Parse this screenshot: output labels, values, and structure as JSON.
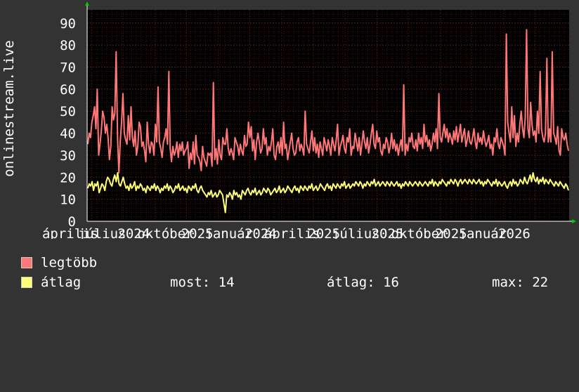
{
  "chart_data": {
    "type": "line",
    "ylabel": "onlinestream.live",
    "ylim": [
      0,
      96
    ],
    "y_ticks": [
      "0",
      "10",
      "20",
      "30",
      "40",
      "50",
      "60",
      "70",
      "80",
      "90"
    ],
    "x_tick_labels": [
      "április",
      "július",
      "2024",
      "október",
      "2025",
      "január",
      "2024",
      "április",
      "2025",
      "július",
      "2025",
      "október",
      "2025",
      "január",
      "2026"
    ],
    "grid": true,
    "background": "#000000",
    "grid_color": "#5a1f1f",
    "series": [
      {
        "name": "legtöbb",
        "color": "#ff7777",
        "values": [
          35,
          40,
          38,
          45,
          48,
          52,
          42,
          60,
          30,
          35,
          41,
          50,
          47,
          40,
          44,
          38,
          28,
          34,
          52,
          46,
          49,
          77,
          38,
          22,
          36,
          45,
          58,
          40,
          37,
          35,
          48,
          37,
          52,
          38,
          34,
          41,
          30,
          34,
          45,
          43,
          34,
          36,
          32,
          27,
          45,
          35,
          31,
          36,
          35,
          30,
          44,
          36,
          61,
          36,
          33,
          29,
          36,
          38,
          42,
          35,
          68,
          33,
          27,
          34,
          30,
          32,
          36,
          29,
          35,
          32,
          36,
          30,
          32,
          33,
          36,
          24,
          31,
          28,
          36,
          26,
          39,
          30,
          29,
          27,
          23,
          34,
          29,
          27,
          25,
          31,
          30,
          31,
          25,
          63,
          28,
          33,
          26,
          37,
          30,
          28,
          38,
          35,
          35,
          42,
          33,
          30,
          33,
          31,
          28,
          38,
          36,
          34,
          30,
          35,
          32,
          30,
          39,
          34,
          35,
          45,
          38,
          43,
          32,
          37,
          28,
          36,
          40,
          36,
          31,
          33,
          42,
          35,
          38,
          30,
          34,
          32,
          36,
          42,
          30,
          28,
          34,
          36,
          31,
          38,
          30,
          45,
          33,
          35,
          28,
          32,
          36,
          40,
          33,
          30,
          31,
          36,
          38,
          32,
          35,
          33,
          30,
          50,
          35,
          33,
          31,
          36,
          41,
          32,
          38,
          31,
          35,
          29,
          36,
          33,
          30,
          38,
          35,
          32,
          37,
          34,
          30,
          38,
          35,
          32,
          37,
          44,
          30,
          34,
          36,
          39,
          33,
          31,
          38,
          36,
          42,
          30,
          34,
          33,
          40,
          36,
          32,
          38,
          30,
          35,
          41,
          36,
          33,
          38,
          31,
          35,
          40,
          44,
          35,
          33,
          41,
          36,
          38,
          32,
          30,
          35,
          33,
          38,
          36,
          31,
          34,
          40,
          33,
          37,
          32,
          35,
          30,
          34,
          37,
          32,
          62,
          30,
          35,
          32,
          38,
          36,
          40,
          34,
          33,
          37,
          32,
          40,
          35,
          38,
          33,
          44,
          36,
          39,
          34,
          37,
          32,
          35,
          40,
          36,
          42,
          33,
          58,
          38,
          36,
          40,
          44,
          38,
          42,
          36,
          40,
          38,
          35,
          41,
          37,
          43,
          36,
          40,
          44,
          36,
          39,
          42,
          34,
          37,
          41,
          36,
          35,
          38,
          42,
          36,
          33,
          40,
          36,
          38,
          35,
          41,
          37,
          34,
          36,
          39,
          33,
          35,
          30,
          38,
          36,
          42,
          35,
          33,
          38,
          36,
          34,
          30,
          85,
          45,
          40,
          36,
          52,
          38,
          48,
          34,
          40,
          36,
          44,
          50,
          42,
          38,
          47,
          87,
          42,
          38,
          54,
          44,
          39,
          41,
          36,
          50,
          40,
          68,
          42,
          38,
          36,
          40,
          74,
          36,
          42,
          36,
          77,
          40,
          38,
          35,
          43,
          32,
          30,
          42,
          38,
          37,
          40,
          35,
          32
        ]
      },
      {
        "name": "átlag",
        "color": "#ffff77",
        "values": [
          15,
          17,
          16,
          18,
          14,
          17,
          16,
          18,
          13,
          15,
          17,
          16,
          14,
          18,
          20,
          19,
          17,
          16,
          19,
          21,
          18,
          22,
          17,
          16,
          18,
          20,
          17,
          15,
          16,
          14,
          17,
          15,
          16,
          18,
          14,
          16,
          15,
          17,
          16,
          14,
          15,
          13,
          16,
          15,
          14,
          16,
          15,
          17,
          14,
          16,
          15,
          13,
          15,
          14,
          16,
          15,
          17,
          14,
          16,
          15,
          13,
          14,
          16,
          15,
          17,
          14,
          15,
          16,
          14,
          15,
          13,
          16,
          15,
          14,
          16,
          15,
          17,
          14,
          13,
          15,
          16,
          14,
          13,
          12,
          11,
          13,
          12,
          14,
          11,
          12,
          13,
          11,
          12,
          14,
          13,
          12,
          8,
          4,
          12,
          11,
          13,
          12,
          10,
          14,
          12,
          13,
          11,
          12,
          10,
          14,
          13,
          12,
          14,
          15,
          13,
          12,
          14,
          13,
          15,
          12,
          13,
          14,
          12,
          13,
          15,
          14,
          13,
          15,
          14,
          12,
          13,
          14,
          15,
          13,
          14,
          16,
          13,
          14,
          15,
          13,
          14,
          16,
          15,
          14,
          13,
          15,
          16,
          14,
          15,
          13,
          16,
          15,
          14,
          16,
          15,
          14,
          16,
          15,
          17,
          14,
          15,
          16,
          14,
          15,
          17,
          16,
          15,
          14,
          16,
          17,
          15,
          16,
          14,
          17,
          16,
          15,
          17,
          16,
          15,
          17,
          16,
          18,
          15,
          16,
          17,
          15,
          16,
          17,
          16,
          18,
          17,
          16,
          18,
          17,
          15,
          17,
          16,
          18,
          17,
          16,
          18,
          17,
          19,
          16,
          17,
          18,
          16,
          17,
          18,
          17,
          16,
          18,
          17,
          16,
          18,
          17,
          16,
          17,
          18,
          16,
          17,
          15,
          17,
          16,
          18,
          17,
          16,
          18,
          17,
          16,
          17,
          18,
          17,
          16,
          18,
          17,
          16,
          17,
          18,
          17,
          16,
          18,
          17,
          19,
          16,
          18,
          17,
          16,
          18,
          17,
          19,
          18,
          17,
          16,
          18,
          17,
          19,
          18,
          17,
          19,
          18,
          16,
          18,
          19,
          17,
          18,
          19,
          18,
          17,
          19,
          18,
          17,
          19,
          18,
          17,
          18,
          19,
          17,
          18,
          16,
          18,
          17,
          19,
          18,
          17,
          16,
          18,
          17,
          19,
          16,
          18,
          17,
          16,
          17,
          18,
          16,
          15,
          17,
          18,
          16,
          19,
          17,
          18,
          16,
          17,
          19,
          18,
          17,
          20,
          18,
          17,
          19,
          21,
          18,
          22,
          19,
          18,
          20,
          17,
          19,
          18,
          20,
          17,
          19,
          18,
          17,
          19,
          18,
          17,
          16,
          18,
          17,
          16,
          18,
          17,
          16,
          15,
          17,
          16,
          14
        ]
      }
    ]
  },
  "legend": [
    {
      "name": "legtöbb",
      "color": "#ff7777"
    },
    {
      "name": "átlag",
      "color": "#ffff77",
      "stats": {
        "most_label": "most:",
        "most_value": "14",
        "atlag_label": "átlag:",
        "atlag_value": "16",
        "max_label": "max:",
        "max_value": "22"
      }
    }
  ]
}
